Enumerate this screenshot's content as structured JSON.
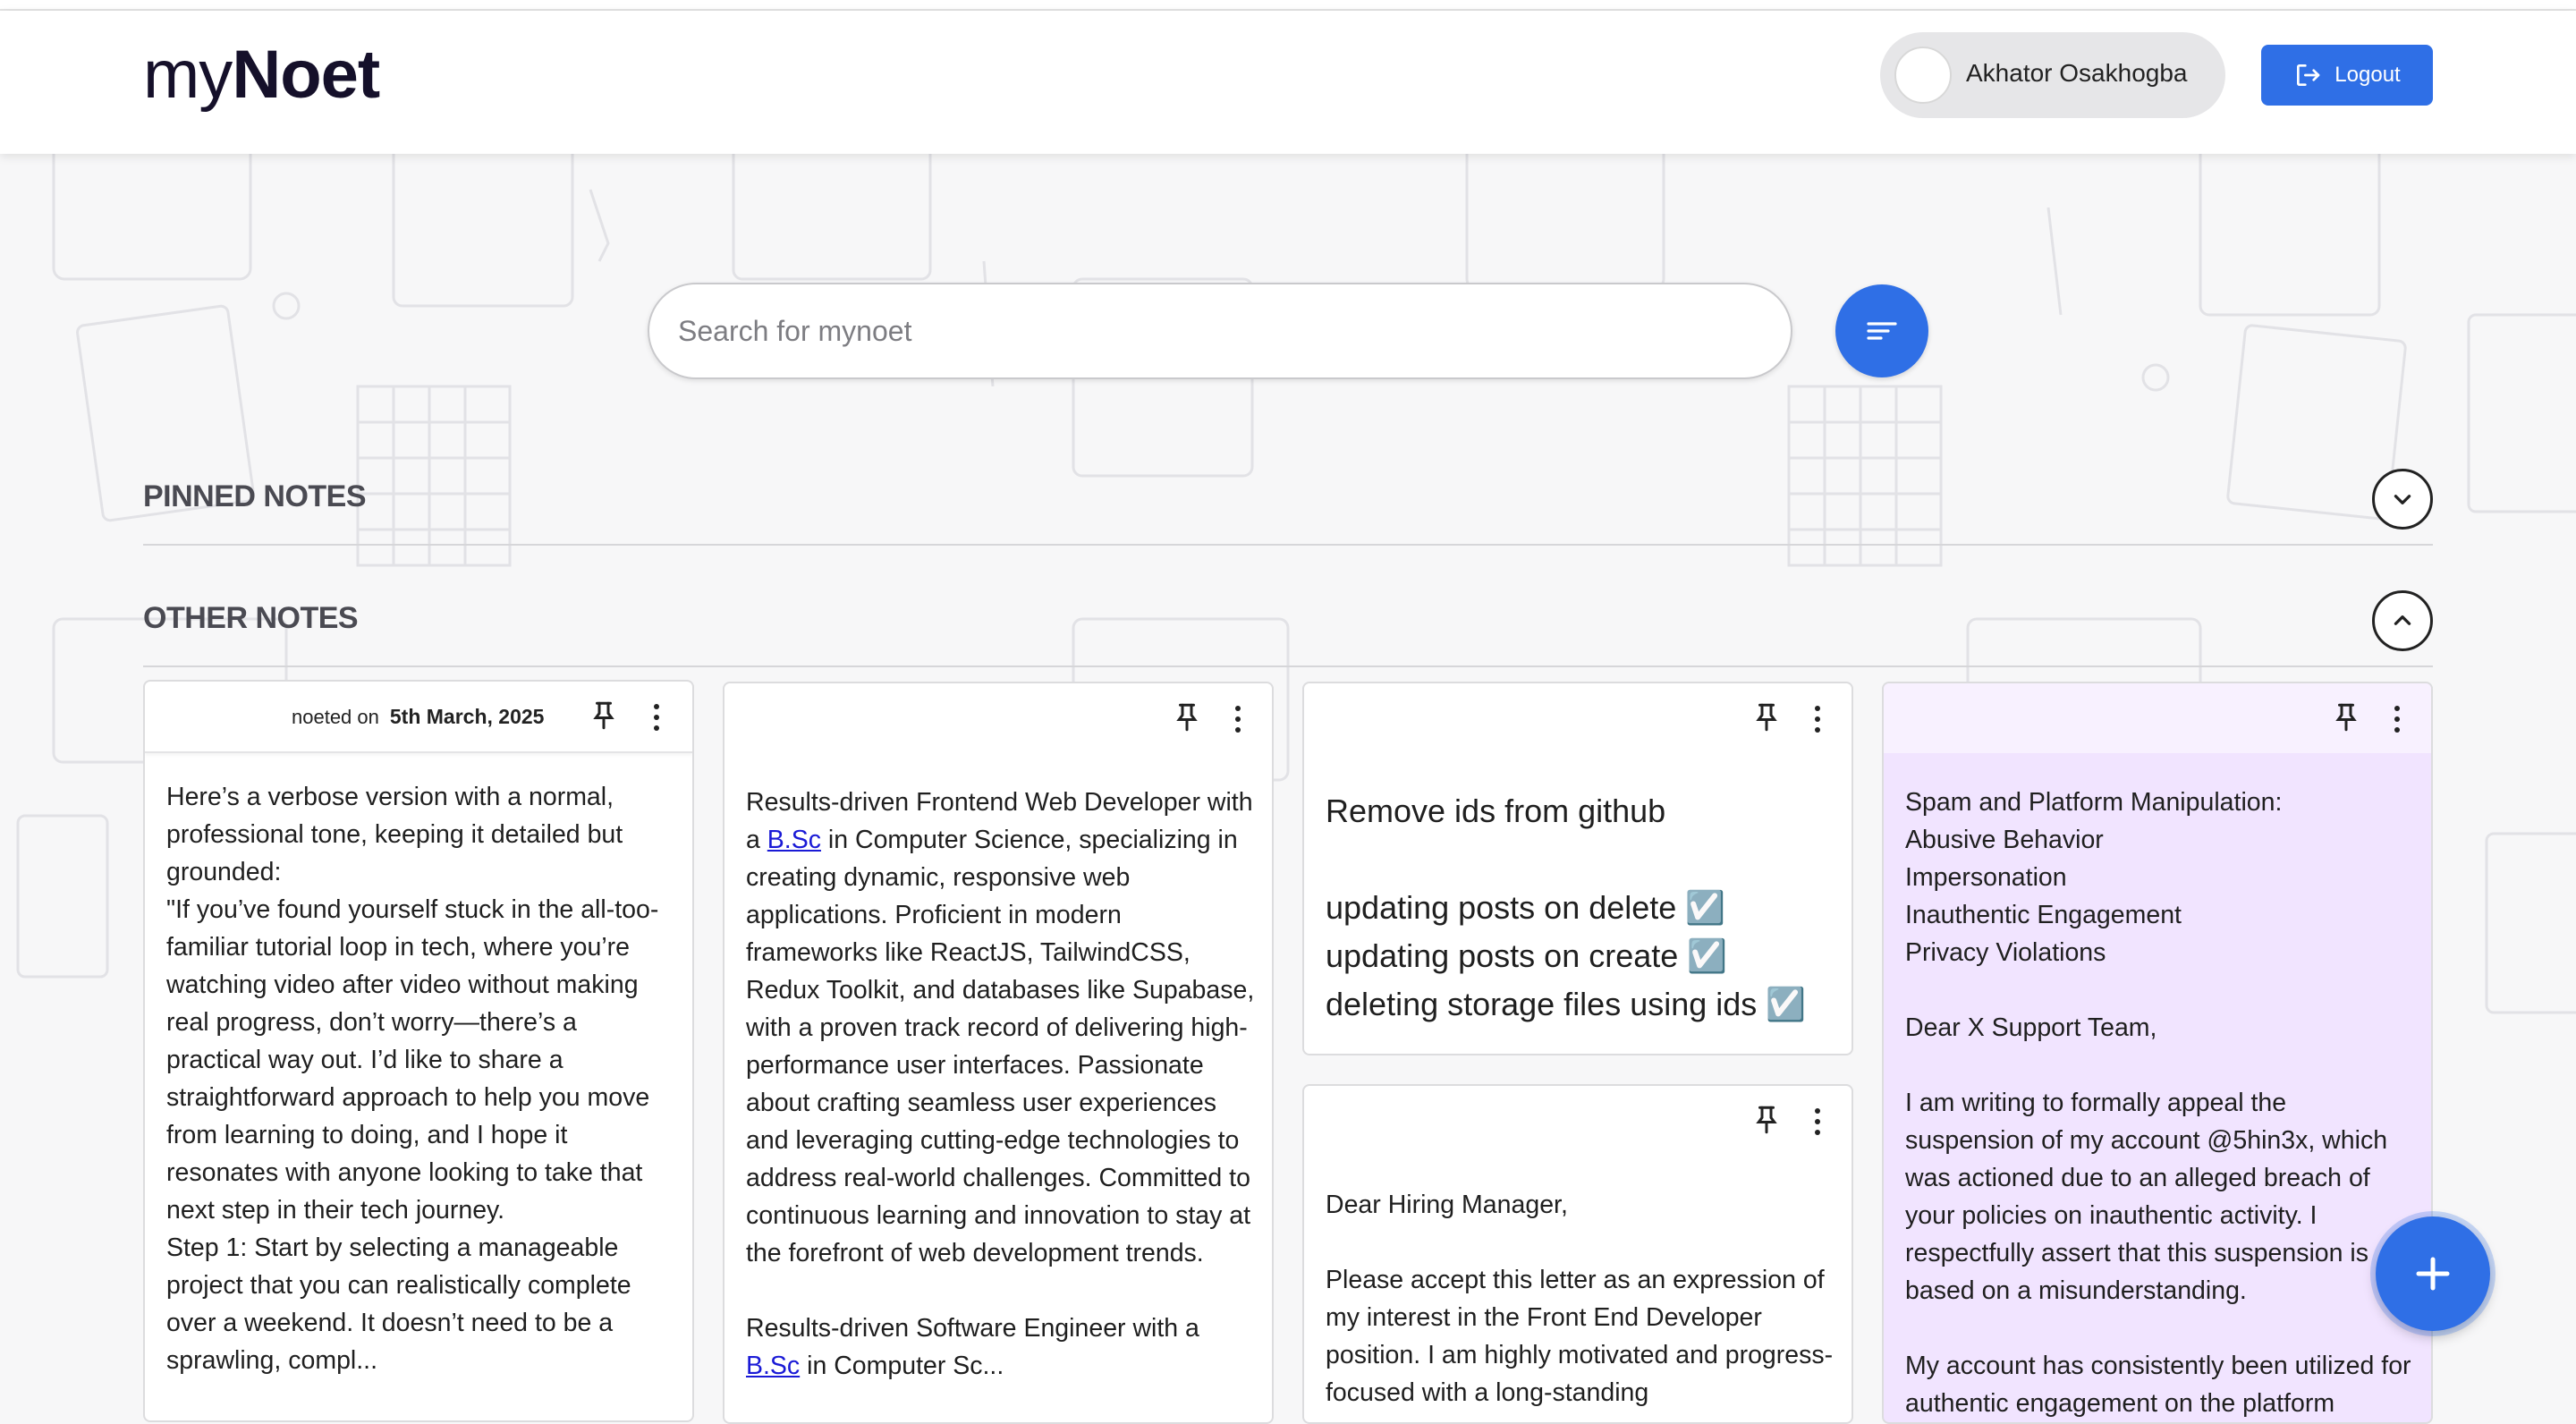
{
  "app": {
    "logo_prefix": "my",
    "logo_suffix": "Noet"
  },
  "header": {
    "user_name": "Akhator Osakhogba",
    "logout_label": "Logout"
  },
  "search": {
    "placeholder": "Search for mynoet",
    "value": ""
  },
  "sections": {
    "pinned": "PINNED NOTES",
    "other": "OTHER NOTES"
  },
  "notes": [
    {
      "meta_label": "noeted on",
      "meta_date": "5th March, 2025",
      "color": "#ffffff",
      "text": "Here’s a verbose version with a normal, professional tone, keeping it detailed but grounded:\n\"If you’ve found yourself stuck in the all-too-familiar tutorial loop in tech, where you’re watching video after video without making real progress, don’t worry—there’s a practical way out. I’d like to share a straightforward approach to help you move from learning to doing, and I hope it resonates with anyone looking to take that next step in their tech journey.\nStep 1: Start by selecting a manageable project that you can realistically complete over a weekend. It doesn’t need to be a sprawling, compl..."
    },
    {
      "color": "#ffffff",
      "text_before_link": "Results-driven Frontend Web Developer with a ",
      "link_text": "B.Sc",
      "text_after_link": " in Computer Science, specializing in creating dynamic, responsive web applications. Proficient in modern frameworks like ReactJS, TailwindCSS, Redux Toolkit, and databases like Supabase, with a proven track record of delivering high-performance user interfaces. Passionate about crafting seamless user experiences and leveraging cutting-edge technologies to address real-world challenges. Committed to continuous learning and innovation to stay at the forefront of web development trends.\n\nResults-driven Software Engineer with a ",
      "link_text_2": "B.Sc",
      "text_after_link_2": " in Computer Sc..."
    },
    {
      "color": "#ffffff",
      "text": "Remove ids from github\n\nupdating posts on delete ☑️\nupdating posts on create ☑️\ndeleting storage files using ids ☑️"
    },
    {
      "color": "#ffffff",
      "text": "Dear Hiring Manager,\n\nPlease accept this letter as an expression of my interest in the Front End Developer position. I am highly motivated and progress-focused with a long-standing"
    },
    {
      "color": "#f1e4ff",
      "text": "Spam and Platform Manipulation:\nAbusive Behavior\nImpersonation\nInauthentic Engagement\nPrivacy Violations\n\nDear X Support Team,\n\nI am writing to formally appeal the suspension of my account @5hin3x, which was actioned due to an alleged breach of your policies on inauthentic activity. I respectfully assert that this suspension is based on a misunderstanding.\n\nMy account has consistently been utilized for authentic engagement on the platform"
    }
  ],
  "icons": {
    "pin": "pin-icon",
    "more": "more-vertical-icon",
    "filter": "sort-filter-icon",
    "add": "plus-icon",
    "logout": "logout-icon",
    "pinned_toggle": "chevron-down-icon",
    "other_toggle": "chevron-up-icon"
  },
  "colors": {
    "accent": "#2f6fe6",
    "purple_note": "#f1e4ff"
  }
}
